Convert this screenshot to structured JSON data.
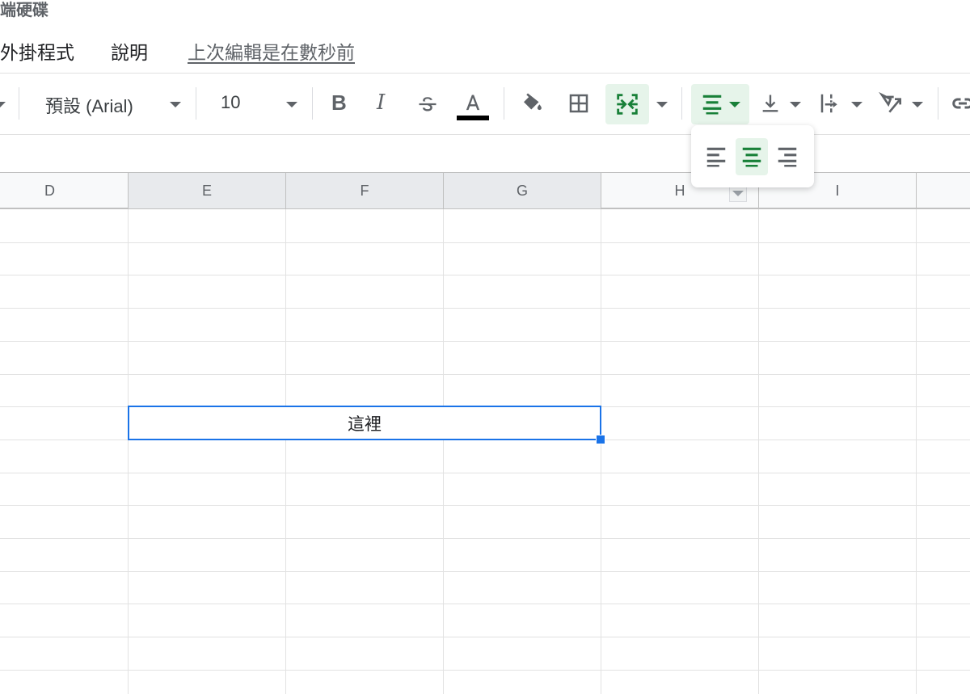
{
  "doc": {
    "title": "端硬碟"
  },
  "menu": {
    "items": [
      "外掛程式",
      "說明"
    ],
    "last_edit": "上次編輯是在數秒前"
  },
  "toolbar": {
    "font": "預設 (Arial)",
    "font_size": "10",
    "bold": "B",
    "italic": "I",
    "text_color": "#000000",
    "accent": "#188038"
  },
  "columns": [
    "D",
    "E",
    "F",
    "G",
    "H",
    "I"
  ],
  "cell": {
    "value": "這裡",
    "range": "E:G merged",
    "align": "center"
  },
  "align_menu": {
    "options": [
      "left",
      "center",
      "right"
    ],
    "selected": "center"
  }
}
